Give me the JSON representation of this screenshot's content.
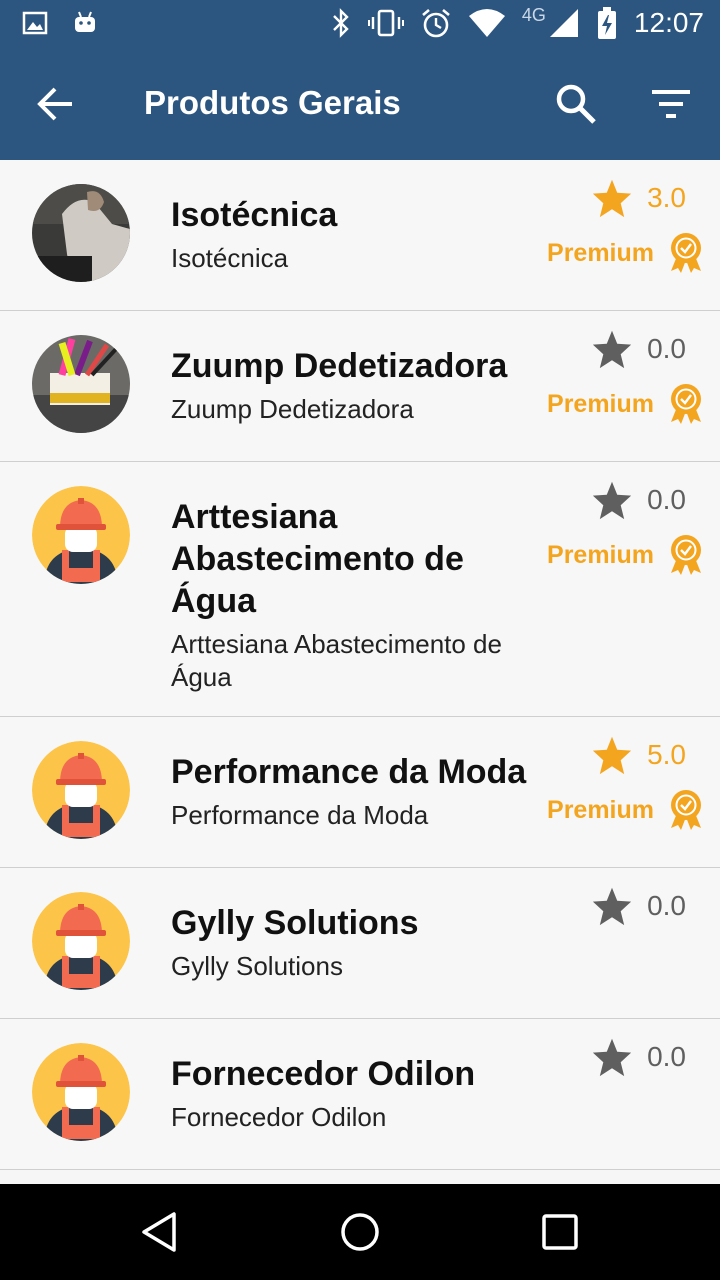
{
  "status_bar": {
    "network_label": "4G",
    "time": "12:07"
  },
  "app_bar": {
    "title": "Produtos Gerais"
  },
  "colors": {
    "primary": "#2c5680",
    "accent_orange": "#f4a51f",
    "star_gray": "#5f5f5f"
  },
  "items": [
    {
      "name": "Isotécnica",
      "subtitle": "Isotécnica",
      "rating": "3.0",
      "rated": true,
      "premium": true,
      "premium_label": "Premium",
      "avatar": "photo-person"
    },
    {
      "name": "Zuump Dedetizadora",
      "subtitle": "Zuump Dedetizadora",
      "rating": "0.0",
      "rated": false,
      "premium": true,
      "premium_label": "Premium",
      "avatar": "photo-box"
    },
    {
      "name": "Arttesiana Abastecimento de Água",
      "subtitle": "Arttesiana Abastecimento de Água",
      "rating": "0.0",
      "rated": false,
      "premium": true,
      "premium_label": "Premium",
      "avatar": "worker-icon"
    },
    {
      "name": "Performance da Moda",
      "subtitle": "Performance da Moda",
      "rating": "5.0",
      "rated": true,
      "premium": true,
      "premium_label": "Premium",
      "avatar": "worker-icon"
    },
    {
      "name": "Gylly Solutions",
      "subtitle": "Gylly Solutions",
      "rating": "0.0",
      "rated": false,
      "premium": false,
      "avatar": "worker-icon"
    },
    {
      "name": "Fornecedor Odilon",
      "subtitle": "Fornecedor Odilon",
      "rating": "0.0",
      "rated": false,
      "premium": false,
      "avatar": "worker-icon"
    }
  ]
}
